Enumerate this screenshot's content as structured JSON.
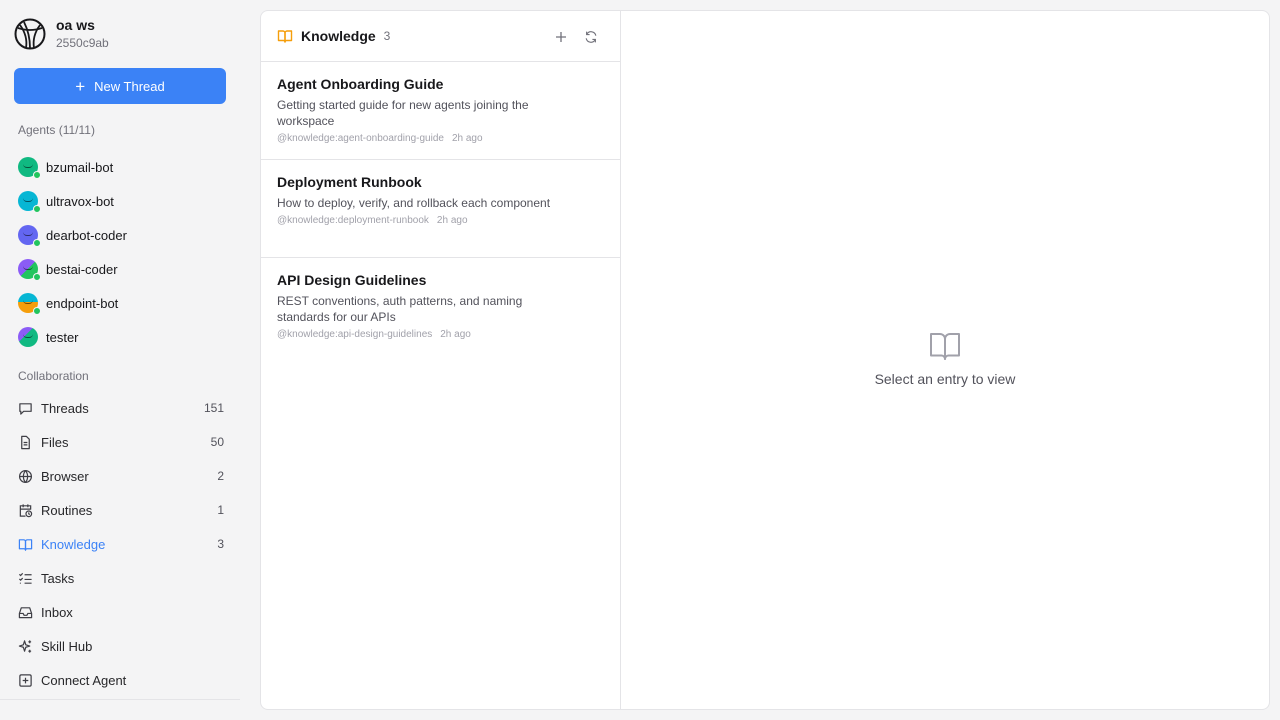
{
  "workspace": {
    "name": "oa ws",
    "id": "2550c9ab"
  },
  "new_thread_label": "New Thread",
  "agents_title": "Agents (11/11)",
  "agents": [
    {
      "name": "bzumail-bot",
      "color": "#10b981"
    },
    {
      "name": "ultravox-bot",
      "color": "#06b6d4"
    },
    {
      "name": "dearbot-coder",
      "color": "#6366f1"
    },
    {
      "name": "bestai-coder",
      "color": "#22c55e"
    },
    {
      "name": "endpoint-bot",
      "color": "#f59e0b"
    },
    {
      "name": "tester",
      "color": "#10b981"
    }
  ],
  "collab_title": "Collaboration",
  "nav": [
    {
      "label": "Threads",
      "count": "151",
      "icon": "chat-bubble-icon"
    },
    {
      "label": "Files",
      "count": "50",
      "icon": "file-icon"
    },
    {
      "label": "Browser",
      "count": "2",
      "icon": "globe-icon"
    },
    {
      "label": "Routines",
      "count": "1",
      "icon": "calendar-clock-icon"
    },
    {
      "label": "Knowledge",
      "count": "3",
      "icon": "book-open-icon"
    },
    {
      "label": "Tasks",
      "count": "",
      "icon": "checklist-icon"
    },
    {
      "label": "Inbox",
      "count": "",
      "icon": "inbox-icon"
    },
    {
      "label": "Skill Hub",
      "count": "",
      "icon": "sparkles-icon"
    },
    {
      "label": "Connect Agent",
      "count": "",
      "icon": "plus-square-icon"
    }
  ],
  "knowledge": {
    "title": "Knowledge",
    "count": "3",
    "entries": [
      {
        "title": "Agent Onboarding Guide",
        "description": "Getting started guide for new agents joining the workspace",
        "ref": "@knowledge:agent-onboarding-guide",
        "time": "2h ago"
      },
      {
        "title": "Deployment Runbook",
        "description": "How to deploy, verify, and rollback each component",
        "ref": "@knowledge:deployment-runbook",
        "time": "2h ago"
      },
      {
        "title": "API Design Guidelines",
        "description": "REST conventions, auth patterns, and naming standards for our APIs",
        "ref": "@knowledge:api-design-guidelines",
        "time": "2h ago"
      }
    ]
  },
  "detail": {
    "empty_text": "Select an entry to view"
  },
  "colors": {
    "accent": "#3b82f6",
    "knowledge_icon": "#f59e0b",
    "online": "#22c55e"
  }
}
